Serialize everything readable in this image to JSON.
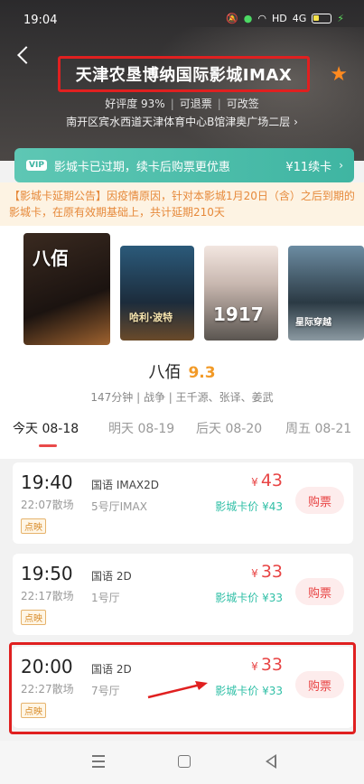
{
  "status_bar": {
    "time": "19:04",
    "network": "HD",
    "signal": "4G"
  },
  "cinema": {
    "title": "天津农垦博纳国际影城IMAX",
    "rating_tag": "好评度 93%",
    "tag_2": "可退票",
    "tag_3": "可改签",
    "address": "南开区宾水西道天津体育中心B馆津奥广场二层 ›"
  },
  "member_card": {
    "badge": "VIP",
    "text": "影城卡已过期，续卡后购票更优惠",
    "price": "¥11续卡",
    "chevron": "›"
  },
  "notice": "【影城卡延期公告】因疫情原因，针对本影城1月20日（含）之后到期的影城卡，在原有效期基础上，共计延期210天",
  "posters": [
    {
      "text": "八佰"
    },
    {
      "text": "哈利·波特"
    },
    {
      "text": "1917"
    },
    {
      "text": "星际穿越"
    }
  ],
  "movie": {
    "name": "八佰",
    "score": "9.3",
    "meta": "147分钟 | 战争 | 王千源、张译、姜武"
  },
  "date_tabs": [
    {
      "label": "今天 08-18"
    },
    {
      "label": "明天 08-19"
    },
    {
      "label": "后天 08-20"
    },
    {
      "label": "周五 08-21"
    }
  ],
  "showtimes": [
    {
      "start": "19:40",
      "end": "22:07散场",
      "tag": "点映",
      "lang": "国语 IMAX2D",
      "hall": "5号厅IMAX",
      "yen": "¥",
      "price": "43",
      "card_price": "影城卡价 ¥43",
      "buy": "购票"
    },
    {
      "start": "19:50",
      "end": "22:17散场",
      "tag": "点映",
      "lang": "国语 2D",
      "hall": "1号厅",
      "yen": "¥",
      "price": "33",
      "card_price": "影城卡价 ¥33",
      "buy": "购票"
    },
    {
      "start": "20:00",
      "end": "22:27散场",
      "tag": "点映",
      "lang": "国语 2D",
      "hall": "7号厅",
      "yen": "¥",
      "price": "33",
      "card_price": "影城卡价 ¥33",
      "buy": "购票"
    }
  ],
  "colors": {
    "accent_red": "#e84545",
    "teal": "#3fb5a2",
    "orange": "#f29a27",
    "highlight": "#e02020"
  },
  "icons": {
    "back": "back-arrow-icon",
    "favorite": "star-icon"
  }
}
